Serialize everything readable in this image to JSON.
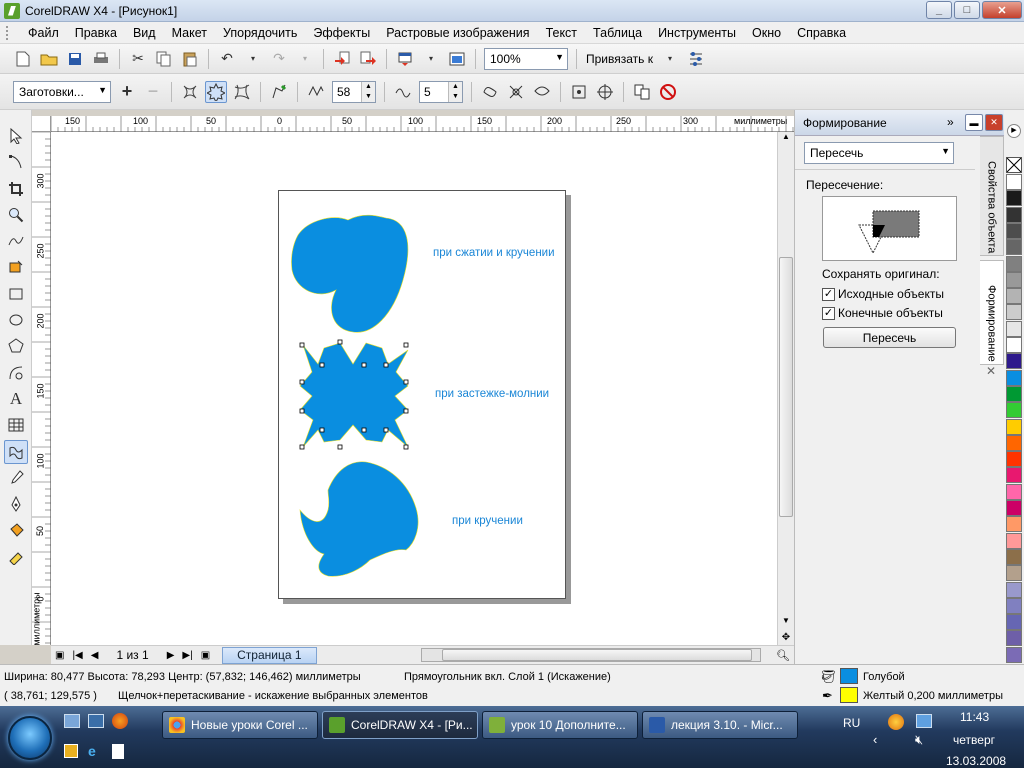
{
  "window": {
    "title": "CorelDRAW X4 - [Рисунок1]",
    "min": "_",
    "max": "□",
    "close": "✕"
  },
  "menu": [
    "Файл",
    "Правка",
    "Вид",
    "Макет",
    "Упорядочить",
    "Эффекты",
    "Растровые изображения",
    "Текст",
    "Таблица",
    "Инструменты",
    "Окно",
    "Справка"
  ],
  "toolbar1": {
    "zoom": "100%",
    "snap": "Привязать к"
  },
  "toolbar2": {
    "presets": "Заготовки...",
    "amplitude": "58",
    "frequency": "5"
  },
  "ruler": {
    "h_ticks": [
      "150",
      "100",
      "50",
      "0",
      "50",
      "100",
      "150",
      "200",
      "250",
      "300"
    ],
    "h_unit": "миллиметры",
    "v_ticks": [
      "300",
      "250",
      "200",
      "150",
      "100",
      "50",
      "0"
    ],
    "v_unit": "миллиметры"
  },
  "page": {
    "labels": [
      "при сжатии и кручении",
      "при застежке-молнии",
      "при кручении"
    ],
    "fill": "#0a8ee0",
    "outline": "#f1e000"
  },
  "pagebar": {
    "counter": "1 из 1",
    "tab": "Страница 1"
  },
  "docker": {
    "title": "Формирование",
    "mode": "Пересечь",
    "section": "Пересечение:",
    "keep_label": "Сохранять оригинал:",
    "check1": "Исходные объекты",
    "check2": "Конечные объекты",
    "button": "Пересечь",
    "tab1": "Свойства объекта",
    "tab2": "Формирование"
  },
  "palette": [
    "#ffffff",
    "#1a1a1a",
    "#333333",
    "#4d4d4d",
    "#666666",
    "#808080",
    "#999999",
    "#b3b3b3",
    "#cccccc",
    "#e6e6e6",
    "#ffffff",
    "#2e1a8c",
    "#0a8ee0",
    "#009933",
    "#33cc33",
    "#ffcc00",
    "#ff6600",
    "#ff3300",
    "#e8186f",
    "#ff66aa",
    "#cc0066",
    "#ff9966",
    "#ff9999",
    "#8c6f4a",
    "#b3a08c",
    "#9999cc",
    "#8080c0",
    "#6666b3",
    "#6e5fa8",
    "#7b6bb5"
  ],
  "status": {
    "size": "Ширина: 80,477  Высота: 78,293  Центр: (57,832; 146,462)  миллиметры",
    "object": "Прямоугольник вкл. Слой 1  (Искажение)",
    "coords": "( 38,761; 129,575 )",
    "hint": "Щелчок+перетаскивание - искажение выбранных элементов",
    "fill_name": "Голубой",
    "outline_name": "Желтый  0,200 миллиметры",
    "fill_color": "#0a8ee0",
    "outline_color": "#ffff00"
  },
  "taskbar": {
    "tasks": [
      "Новые уроки Corel ...",
      "CorelDRAW X4 - [Ри...",
      "урок 10 Дополните...",
      "лекция 3.10. - Micr..."
    ],
    "lang": "RU",
    "time": "11:43",
    "day": "четверг",
    "date": "13.03.2008"
  }
}
